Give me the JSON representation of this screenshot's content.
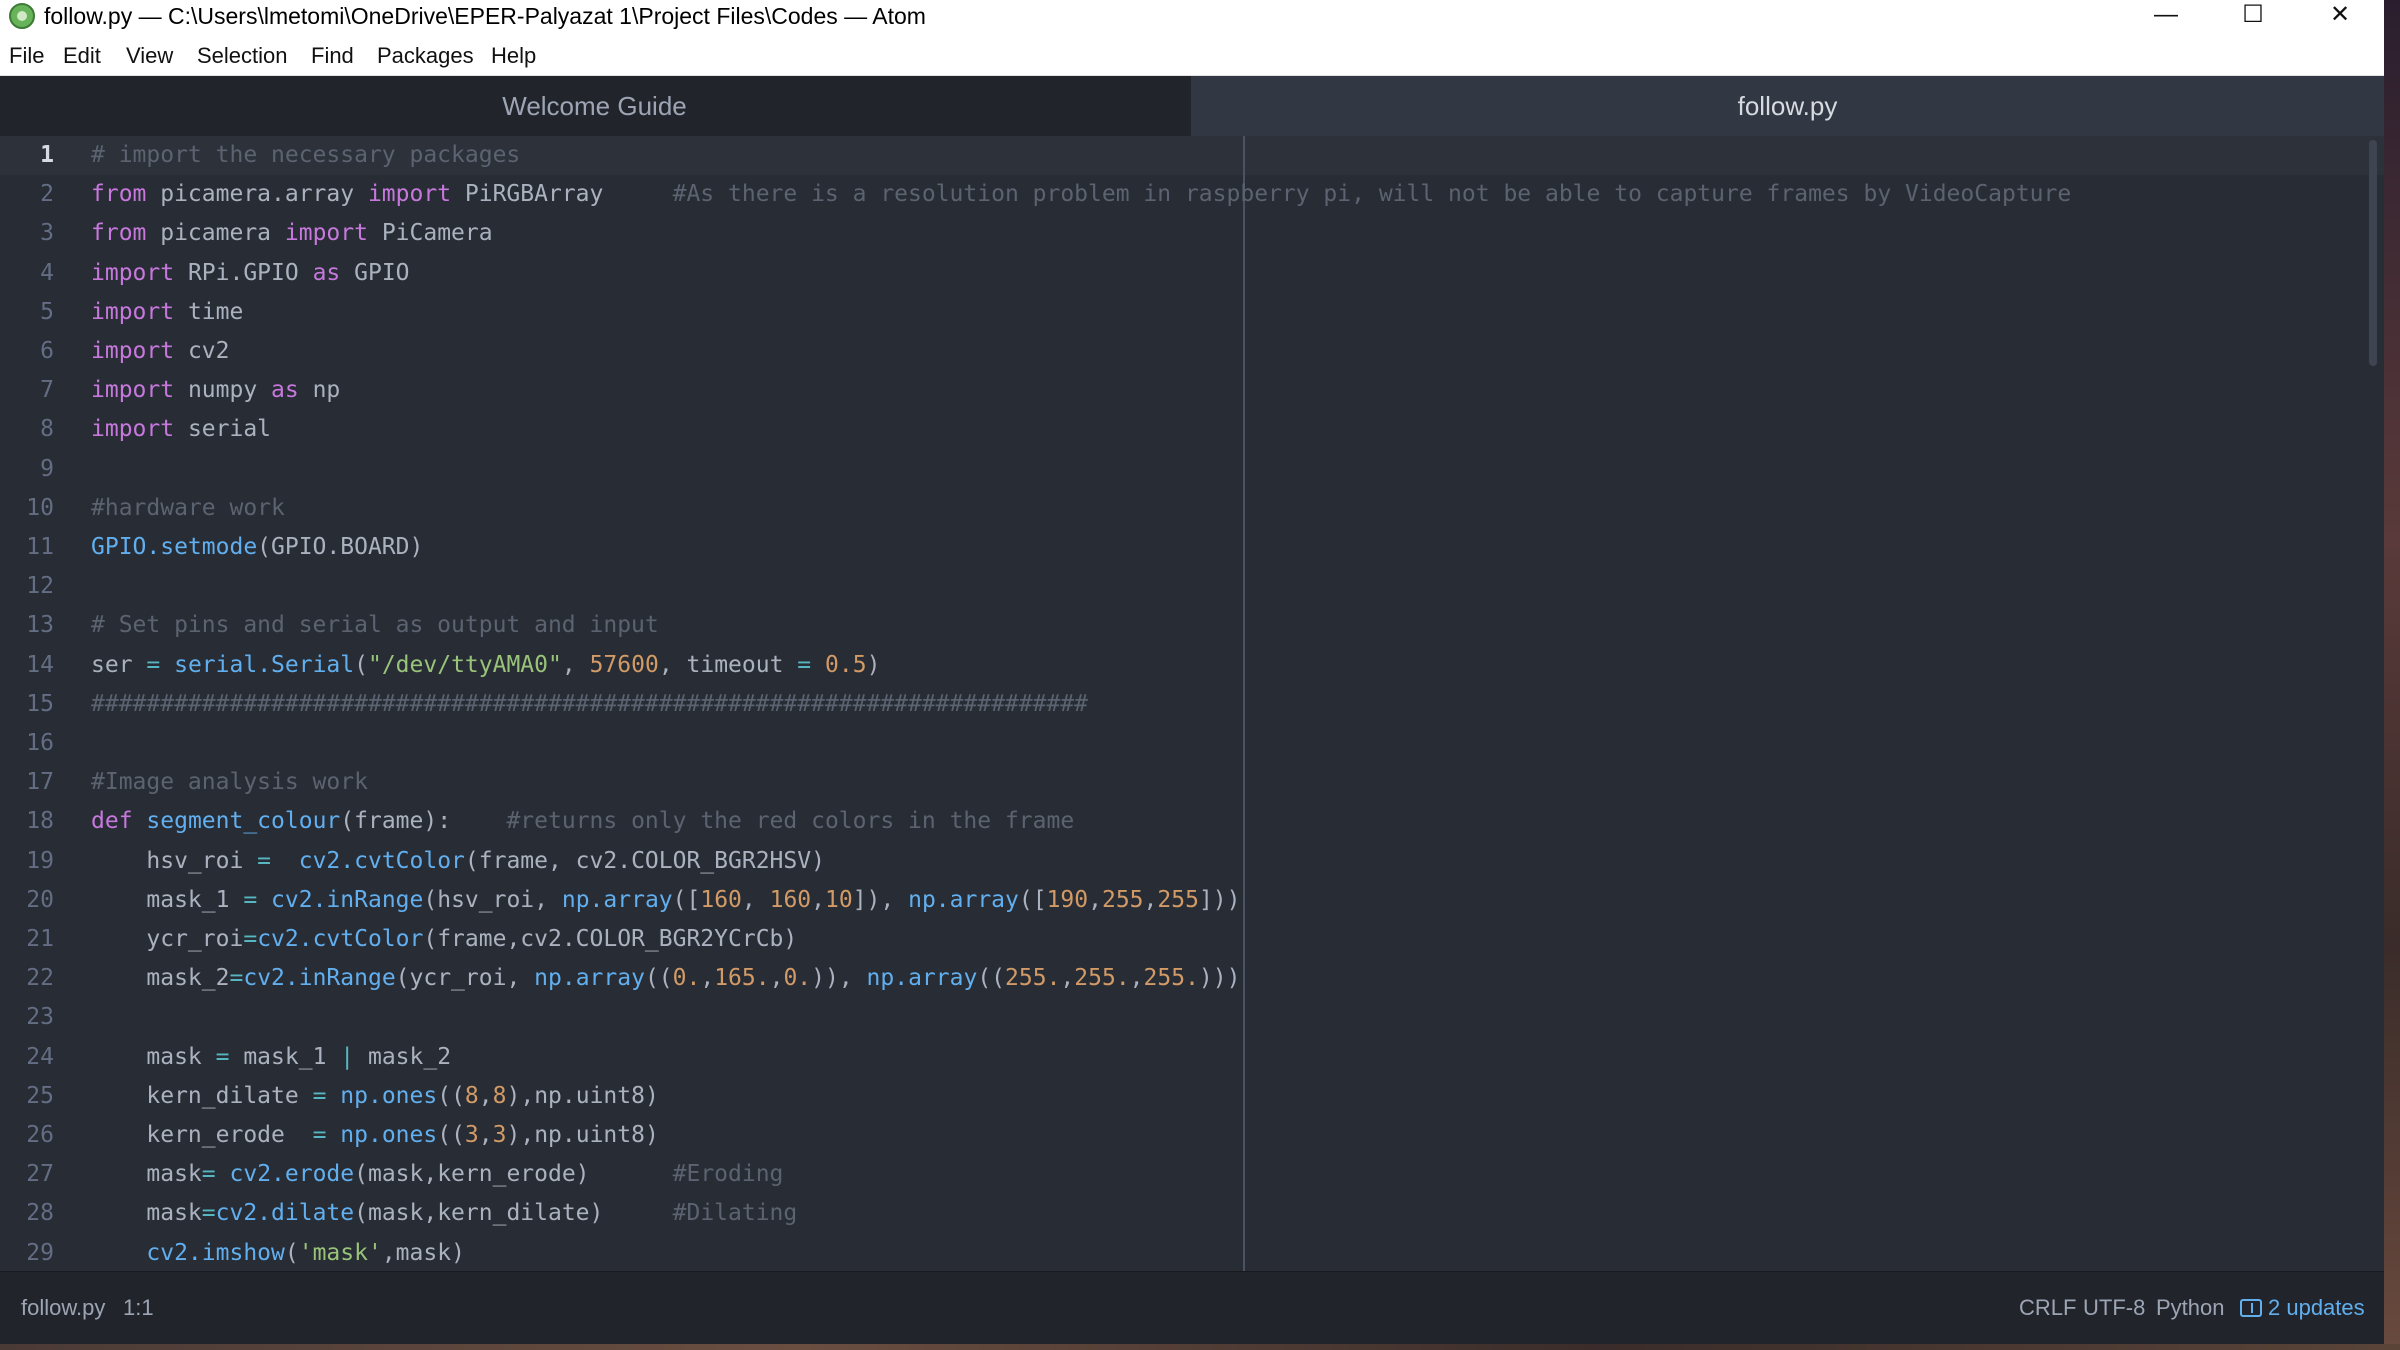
{
  "window": {
    "title": "follow.py — C:\\Users\\lmetomi\\OneDrive\\EPER-Palyazat 1\\Project Files\\Codes — Atom",
    "minimize_glyph": "—",
    "maximize_glyph": "☐",
    "close_glyph": "✕"
  },
  "menu": {
    "items": [
      "File",
      "Edit",
      "View",
      "Selection",
      "Find",
      "Packages",
      "Help"
    ]
  },
  "tabs": [
    {
      "label": "Welcome Guide",
      "active": false
    },
    {
      "label": "follow.py",
      "active": true
    }
  ],
  "editor": {
    "active_line": 1,
    "lines": [
      [
        [
          "cm",
          "# import the necessary packages"
        ]
      ],
      [
        [
          "kw",
          "from"
        ],
        [
          "pl",
          " picamera.array "
        ],
        [
          "kw",
          "import"
        ],
        [
          "pl",
          " PiRGBArray     "
        ],
        [
          "cm",
          "#As there is a resolution problem in raspberry pi, will not be able to capture frames by VideoCapture"
        ]
      ],
      [
        [
          "kw",
          "from"
        ],
        [
          "pl",
          " picamera "
        ],
        [
          "kw",
          "import"
        ],
        [
          "pl",
          " PiCamera"
        ]
      ],
      [
        [
          "kw",
          "import"
        ],
        [
          "pl",
          " RPi.GPIO "
        ],
        [
          "kw",
          "as"
        ],
        [
          "pl",
          " GPIO"
        ]
      ],
      [
        [
          "kw",
          "import"
        ],
        [
          "pl",
          " time"
        ]
      ],
      [
        [
          "kw",
          "import"
        ],
        [
          "pl",
          " cv2"
        ]
      ],
      [
        [
          "kw",
          "import"
        ],
        [
          "pl",
          " numpy "
        ],
        [
          "kw",
          "as"
        ],
        [
          "pl",
          " np"
        ]
      ],
      [
        [
          "kw",
          "import"
        ],
        [
          "pl",
          " serial"
        ]
      ],
      [],
      [
        [
          "cm",
          "#hardware work"
        ]
      ],
      [
        [
          "fn",
          "GPIO.setmode"
        ],
        [
          "pl",
          "(GPIO.BOARD)"
        ]
      ],
      [],
      [
        [
          "cm",
          "# Set pins and serial as output and input"
        ]
      ],
      [
        [
          "pl",
          "ser "
        ],
        [
          "op",
          "="
        ],
        [
          "pl",
          " "
        ],
        [
          "fn",
          "serial.Serial"
        ],
        [
          "pl",
          "("
        ],
        [
          "str",
          "\"/dev/ttyAMA0\""
        ],
        [
          "pl",
          ", "
        ],
        [
          "num",
          "57600"
        ],
        [
          "pl",
          ", timeout "
        ],
        [
          "op",
          "="
        ],
        [
          "pl",
          " "
        ],
        [
          "num",
          "0.5"
        ],
        [
          "pl",
          ")"
        ]
      ],
      [
        [
          "cm",
          "########################################################################"
        ]
      ],
      [],
      [
        [
          "cm",
          "#Image analysis work"
        ]
      ],
      [
        [
          "kw",
          "def"
        ],
        [
          "pl",
          " "
        ],
        [
          "fn",
          "segment_colour"
        ],
        [
          "pl",
          "(frame):    "
        ],
        [
          "cm",
          "#returns only the red colors in the frame"
        ]
      ],
      [
        [
          "pl",
          "    hsv_roi "
        ],
        [
          "op",
          "="
        ],
        [
          "pl",
          "  "
        ],
        [
          "fn",
          "cv2.cvtColor"
        ],
        [
          "pl",
          "(frame, cv2.COLOR_BGR2HSV)"
        ]
      ],
      [
        [
          "pl",
          "    mask_1 "
        ],
        [
          "op",
          "="
        ],
        [
          "pl",
          " "
        ],
        [
          "fn",
          "cv2.inRange"
        ],
        [
          "pl",
          "(hsv_roi, "
        ],
        [
          "fn",
          "np.array"
        ],
        [
          "pl",
          "(["
        ],
        [
          "num",
          "160"
        ],
        [
          "pl",
          ", "
        ],
        [
          "num",
          "160"
        ],
        [
          "pl",
          ","
        ],
        [
          "num",
          "10"
        ],
        [
          "pl",
          "]), "
        ],
        [
          "fn",
          "np.array"
        ],
        [
          "pl",
          "(["
        ],
        [
          "num",
          "190"
        ],
        [
          "pl",
          ","
        ],
        [
          "num",
          "255"
        ],
        [
          "pl",
          ","
        ],
        [
          "num",
          "255"
        ],
        [
          "pl",
          "]))"
        ]
      ],
      [
        [
          "pl",
          "    ycr_roi"
        ],
        [
          "op",
          "="
        ],
        [
          "fn",
          "cv2.cvtColor"
        ],
        [
          "pl",
          "(frame,cv2.COLOR_BGR2YCrCb)"
        ]
      ],
      [
        [
          "pl",
          "    mask_2"
        ],
        [
          "op",
          "="
        ],
        [
          "fn",
          "cv2.inRange"
        ],
        [
          "pl",
          "(ycr_roi, "
        ],
        [
          "fn",
          "np.array"
        ],
        [
          "pl",
          "(("
        ],
        [
          "num",
          "0."
        ],
        [
          "pl",
          ","
        ],
        [
          "num",
          "165."
        ],
        [
          "pl",
          ","
        ],
        [
          "num",
          "0."
        ],
        [
          "pl",
          ")), "
        ],
        [
          "fn",
          "np.array"
        ],
        [
          "pl",
          "(("
        ],
        [
          "num",
          "255."
        ],
        [
          "pl",
          ","
        ],
        [
          "num",
          "255."
        ],
        [
          "pl",
          ","
        ],
        [
          "num",
          "255."
        ],
        [
          "pl",
          ")))"
        ]
      ],
      [],
      [
        [
          "pl",
          "    mask "
        ],
        [
          "op",
          "="
        ],
        [
          "pl",
          " mask_1 "
        ],
        [
          "op",
          "|"
        ],
        [
          "pl",
          " mask_2"
        ]
      ],
      [
        [
          "pl",
          "    kern_dilate "
        ],
        [
          "op",
          "="
        ],
        [
          "pl",
          " "
        ],
        [
          "fn",
          "np.ones"
        ],
        [
          "pl",
          "(("
        ],
        [
          "num",
          "8"
        ],
        [
          "pl",
          ","
        ],
        [
          "num",
          "8"
        ],
        [
          "pl",
          "),np.uint8)"
        ]
      ],
      [
        [
          "pl",
          "    kern_erode  "
        ],
        [
          "op",
          "="
        ],
        [
          "pl",
          " "
        ],
        [
          "fn",
          "np.ones"
        ],
        [
          "pl",
          "(("
        ],
        [
          "num",
          "3"
        ],
        [
          "pl",
          ","
        ],
        [
          "num",
          "3"
        ],
        [
          "pl",
          "),np.uint8)"
        ]
      ],
      [
        [
          "pl",
          "    mask"
        ],
        [
          "op",
          "="
        ],
        [
          "pl",
          " "
        ],
        [
          "fn",
          "cv2.erode"
        ],
        [
          "pl",
          "(mask,kern_erode)      "
        ],
        [
          "cm",
          "#Eroding"
        ]
      ],
      [
        [
          "pl",
          "    mask"
        ],
        [
          "op",
          "="
        ],
        [
          "fn",
          "cv2.dilate"
        ],
        [
          "pl",
          "(mask,kern_dilate)     "
        ],
        [
          "cm",
          "#Dilating"
        ]
      ],
      [
        [
          "pl",
          "    "
        ],
        [
          "fn",
          "cv2.imshow"
        ],
        [
          "pl",
          "("
        ],
        [
          "str",
          "'mask'"
        ],
        [
          "pl",
          ",mask)"
        ]
      ]
    ]
  },
  "status": {
    "file": "follow.py",
    "cursor": "1:1",
    "line_ending": "CRLF",
    "encoding": "UTF-8",
    "grammar": "Python",
    "updates": "2 updates"
  }
}
